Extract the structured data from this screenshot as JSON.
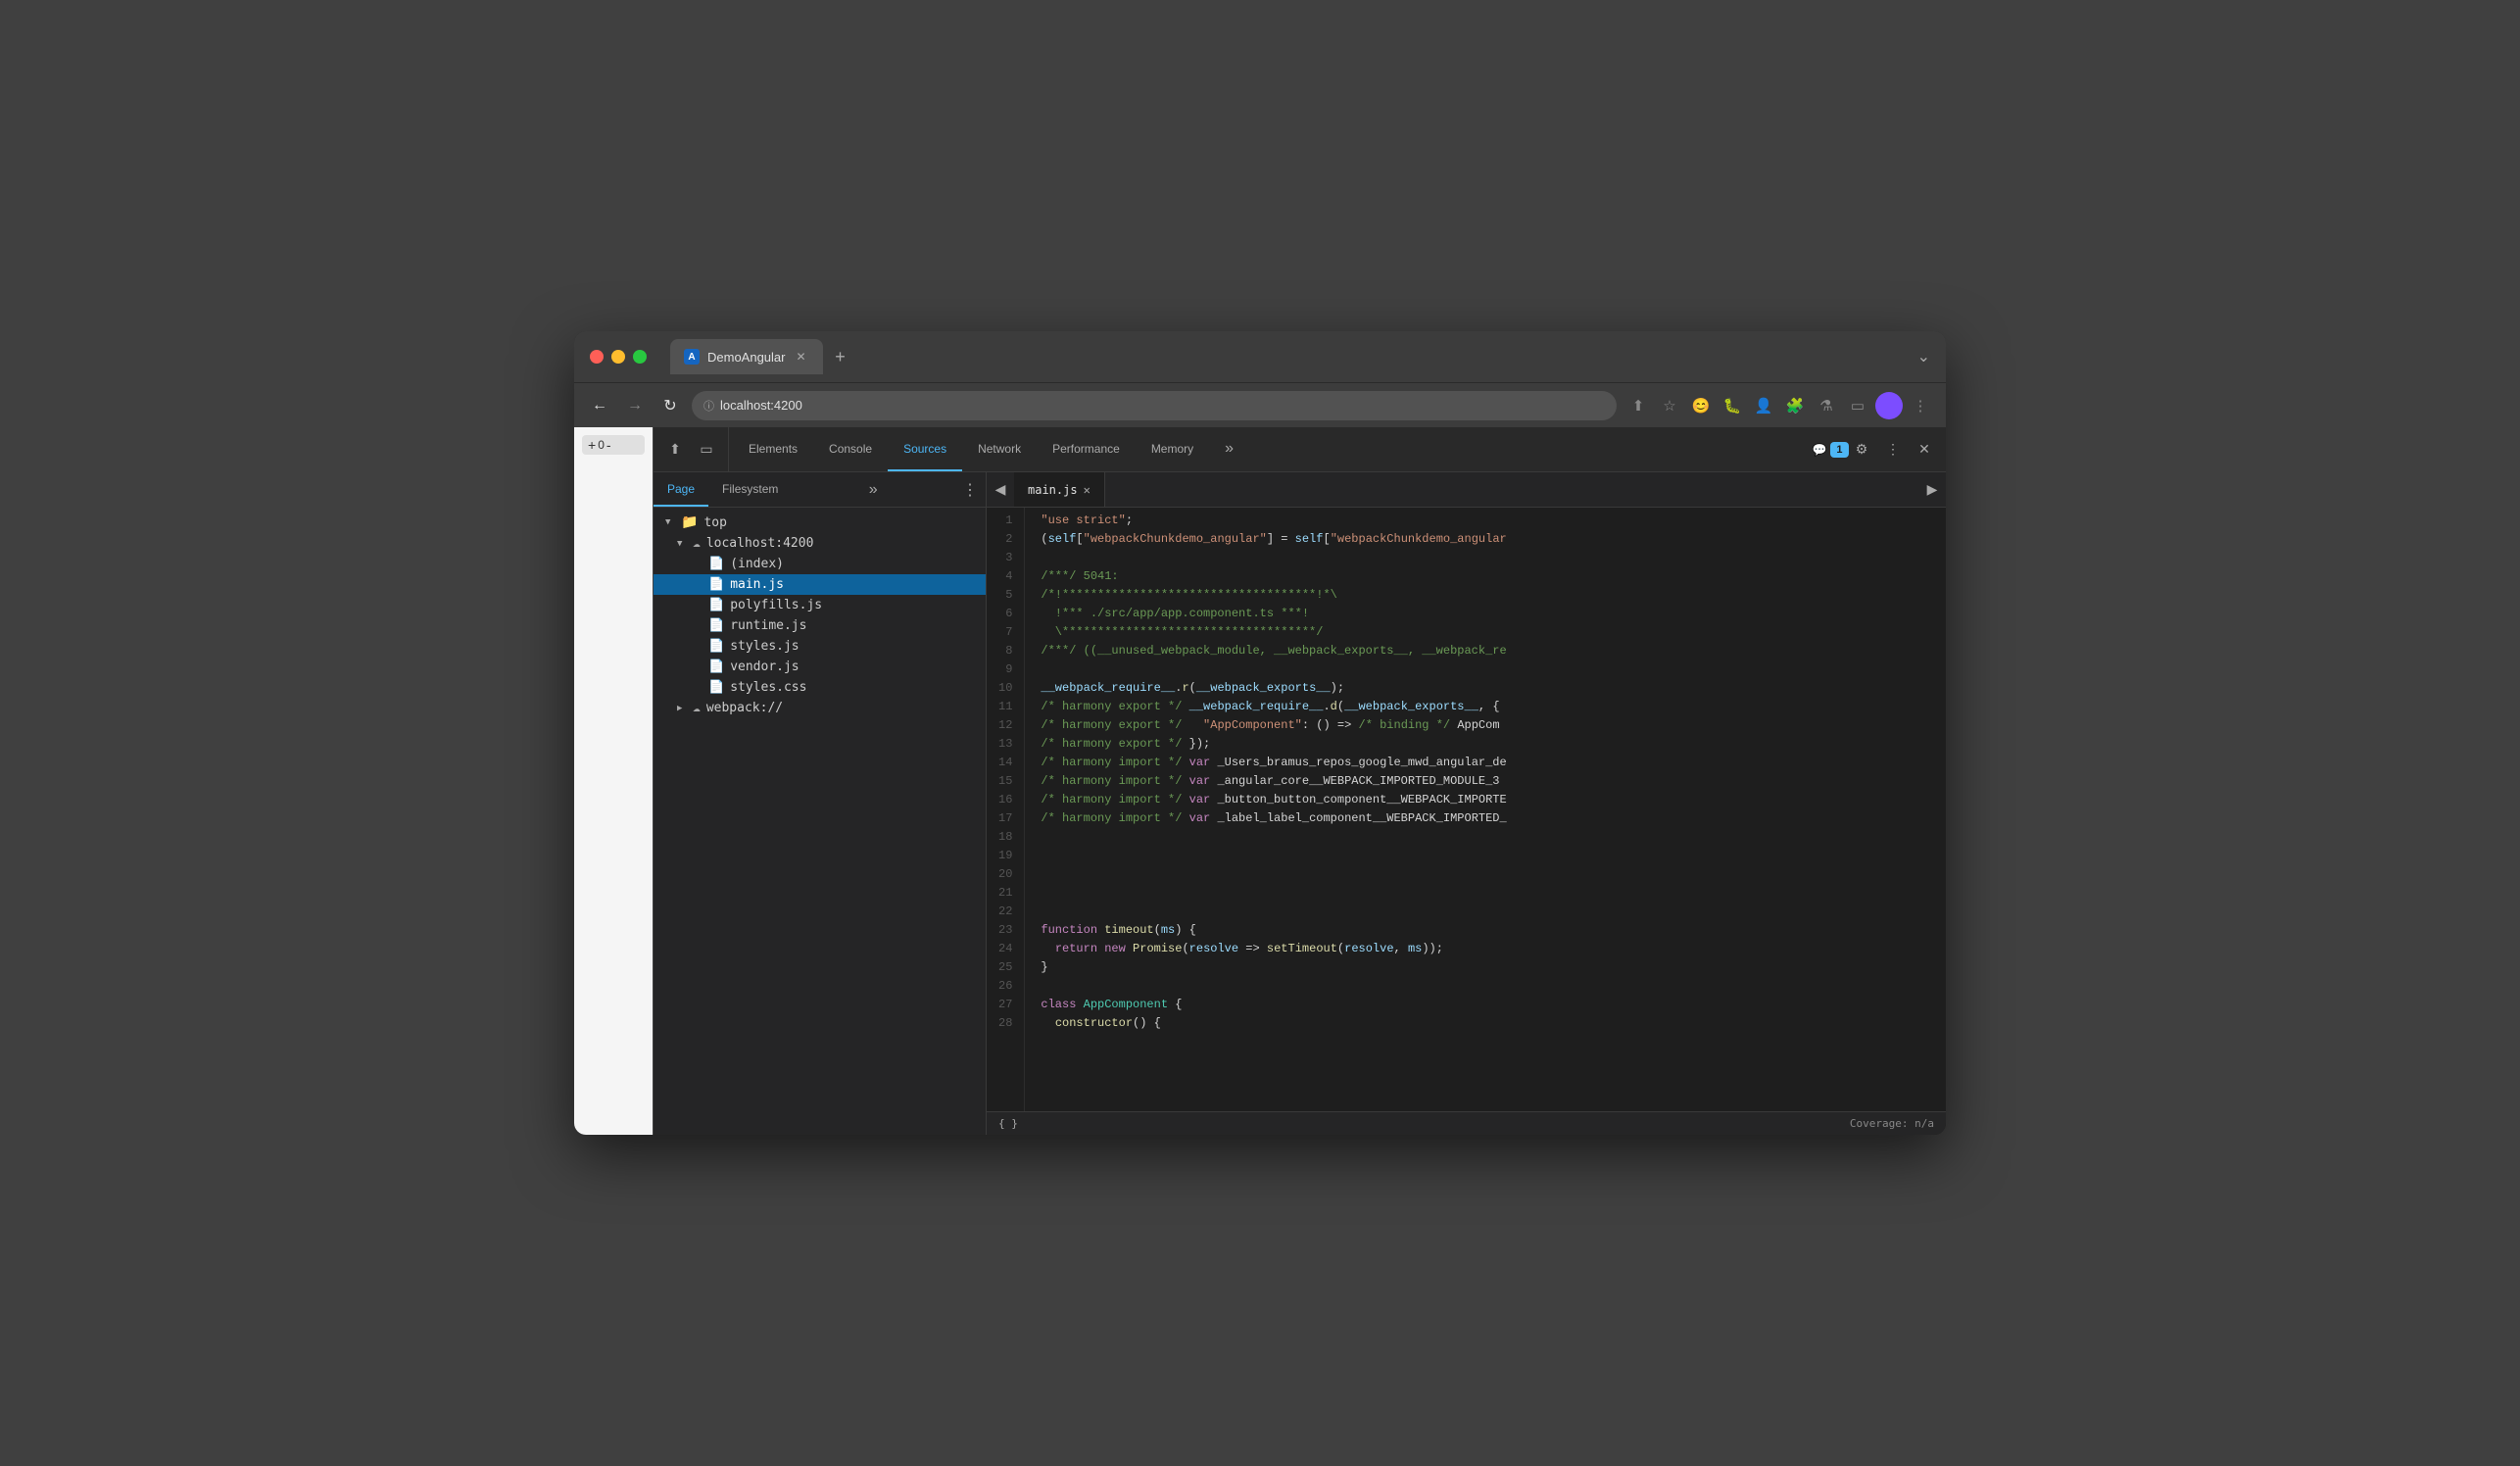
{
  "browser": {
    "tab_label": "DemoAngular",
    "favicon_letter": "A",
    "address": "localhost:4200",
    "new_tab_icon": "+",
    "chevron_icon": "⌄"
  },
  "nav": {
    "back_label": "←",
    "forward_label": "→",
    "reload_label": "↻",
    "address_text": "localhost:4200"
  },
  "zoom": {
    "plus": "+",
    "value": "0",
    "minus": "-"
  },
  "devtools": {
    "tabs": [
      {
        "id": "elements",
        "label": "Elements",
        "active": false
      },
      {
        "id": "console",
        "label": "Console",
        "active": false
      },
      {
        "id": "sources",
        "label": "Sources",
        "active": true
      },
      {
        "id": "network",
        "label": "Network",
        "active": false
      },
      {
        "id": "performance",
        "label": "Performance",
        "active": false
      },
      {
        "id": "memory",
        "label": "Memory",
        "active": false
      }
    ],
    "more_tabs_icon": "»",
    "badge_value": "1",
    "settings_icon": "⚙",
    "more_icon": "⋮",
    "close_icon": "✕",
    "cursor_icon": "⬆",
    "device_icon": "▭"
  },
  "sources_panel": {
    "file_tree_tabs": [
      {
        "id": "page",
        "label": "Page",
        "active": true
      },
      {
        "id": "filesystem",
        "label": "Filesystem",
        "active": false
      }
    ],
    "more_tabs_icon": "»",
    "tree": [
      {
        "id": "top",
        "label": "top",
        "indent": 0,
        "type": "folder",
        "expanded": true,
        "arrow": "▼"
      },
      {
        "id": "localhost",
        "label": "localhost:4200",
        "indent": 1,
        "type": "cloud",
        "expanded": true,
        "arrow": "▼"
      },
      {
        "id": "index",
        "label": "(index)",
        "indent": 2,
        "type": "file-html",
        "arrow": ""
      },
      {
        "id": "main-js",
        "label": "main.js",
        "indent": 2,
        "type": "file-js",
        "arrow": "",
        "selected": true
      },
      {
        "id": "polyfills",
        "label": "polyfills.js",
        "indent": 2,
        "type": "file-js",
        "arrow": ""
      },
      {
        "id": "runtime",
        "label": "runtime.js",
        "indent": 2,
        "type": "file-js",
        "arrow": ""
      },
      {
        "id": "styles-js",
        "label": "styles.js",
        "indent": 2,
        "type": "file-js",
        "arrow": ""
      },
      {
        "id": "vendor",
        "label": "vendor.js",
        "indent": 2,
        "type": "file-js",
        "arrow": ""
      },
      {
        "id": "styles-css",
        "label": "styles.css",
        "indent": 2,
        "type": "file-css",
        "arrow": ""
      },
      {
        "id": "webpack",
        "label": "webpack://",
        "indent": 1,
        "type": "cloud",
        "expanded": false,
        "arrow": "▶"
      }
    ],
    "editor_tab": {
      "label": "main.js",
      "close_icon": "✕"
    },
    "code_lines": [
      {
        "num": 1,
        "content": "\"use strict\";"
      },
      {
        "num": 2,
        "content": "(self[\"webpackChunkdemo_angular\"] = self[\"webpackChunkdemo_angular"
      },
      {
        "num": 3,
        "content": ""
      },
      {
        "num": 4,
        "content": "/***/ 5041:"
      },
      {
        "num": 5,
        "content": "/*!************************************!*\\"
      },
      {
        "num": 6,
        "content": "  !*** ./src/app/app.component.ts ***!"
      },
      {
        "num": 7,
        "content": "  \\***********************************/"
      },
      {
        "num": 8,
        "content": "/***/ ((__unused_webpack_module, __webpack_exports__, __webpack_re"
      },
      {
        "num": 9,
        "content": ""
      },
      {
        "num": 10,
        "content": "__webpack_require__.r(__webpack_exports__);"
      },
      {
        "num": 11,
        "content": "/* harmony export */ __webpack_require__.d(__webpack_exports__, {"
      },
      {
        "num": 12,
        "content": "/* harmony export */   \"AppComponent\": () => (/* binding */ AppCom"
      },
      {
        "num": 13,
        "content": "/* harmony export */ });"
      },
      {
        "num": 14,
        "content": "/* harmony import */ var _Users_bramus_repos_google_mwd_angular_de"
      },
      {
        "num": 15,
        "content": "/* harmony import */ var _angular_core__WEBPACK_IMPORTED_MODULE_3"
      },
      {
        "num": 16,
        "content": "/* harmony import */ var _button_button_component__WEBPACK_IMPORTE"
      },
      {
        "num": 17,
        "content": "/* harmony import */ var _label_label_component__WEBPACK_IMPORTED_"
      },
      {
        "num": 18,
        "content": ""
      },
      {
        "num": 19,
        "content": ""
      },
      {
        "num": 20,
        "content": ""
      },
      {
        "num": 21,
        "content": ""
      },
      {
        "num": 22,
        "content": ""
      },
      {
        "num": 23,
        "content": "function timeout(ms) {"
      },
      {
        "num": 24,
        "content": "  return new Promise(resolve => setTimeout(resolve, ms));"
      },
      {
        "num": 25,
        "content": "}"
      },
      {
        "num": 26,
        "content": ""
      },
      {
        "num": 27,
        "content": "class AppComponent {"
      },
      {
        "num": 28,
        "content": "  constructor() {"
      }
    ],
    "status_bar": {
      "format_label": "{ }",
      "coverage_label": "Coverage: n/a"
    }
  }
}
